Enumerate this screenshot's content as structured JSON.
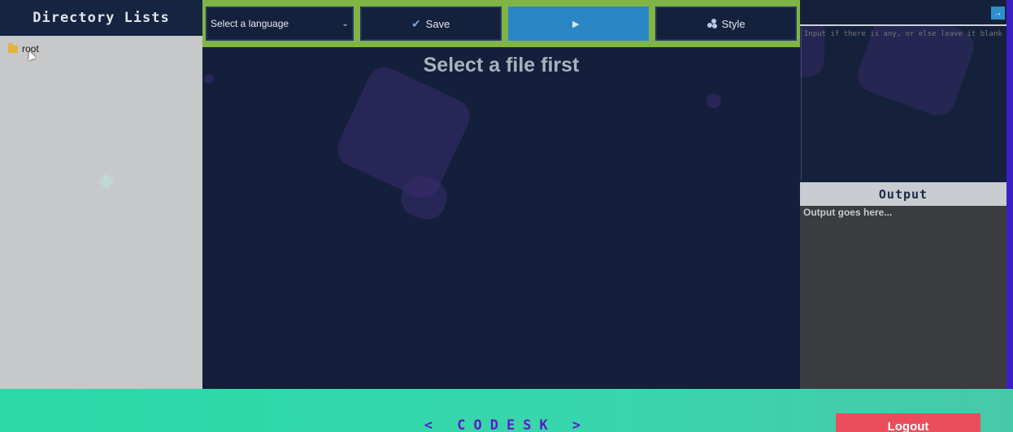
{
  "sidebar": {
    "title": "Directory Lists",
    "tree": [
      {
        "label": "root",
        "icon": "folder-icon"
      }
    ]
  },
  "toolbar": {
    "language_select": {
      "selected": "Select a language"
    },
    "save_label": "Save",
    "run_label": "",
    "style_label": "Style"
  },
  "editor": {
    "placeholder_message": "Select a file first"
  },
  "right_panel": {
    "input_placeholder": "Input if there is any, or else leave it blank",
    "expand_button": "→",
    "output_title": "Output",
    "output_placeholder": "Output goes here..."
  },
  "footer": {
    "brand": "< CODESK >",
    "logout_label": "Logout"
  },
  "colors": {
    "toolbar_bg": "#7fb546",
    "run_button": "#2b86c5",
    "footer_bg": "#2ad9a6",
    "brand_text": "#5b1cc9",
    "logout_bg": "#ea4e5d"
  }
}
